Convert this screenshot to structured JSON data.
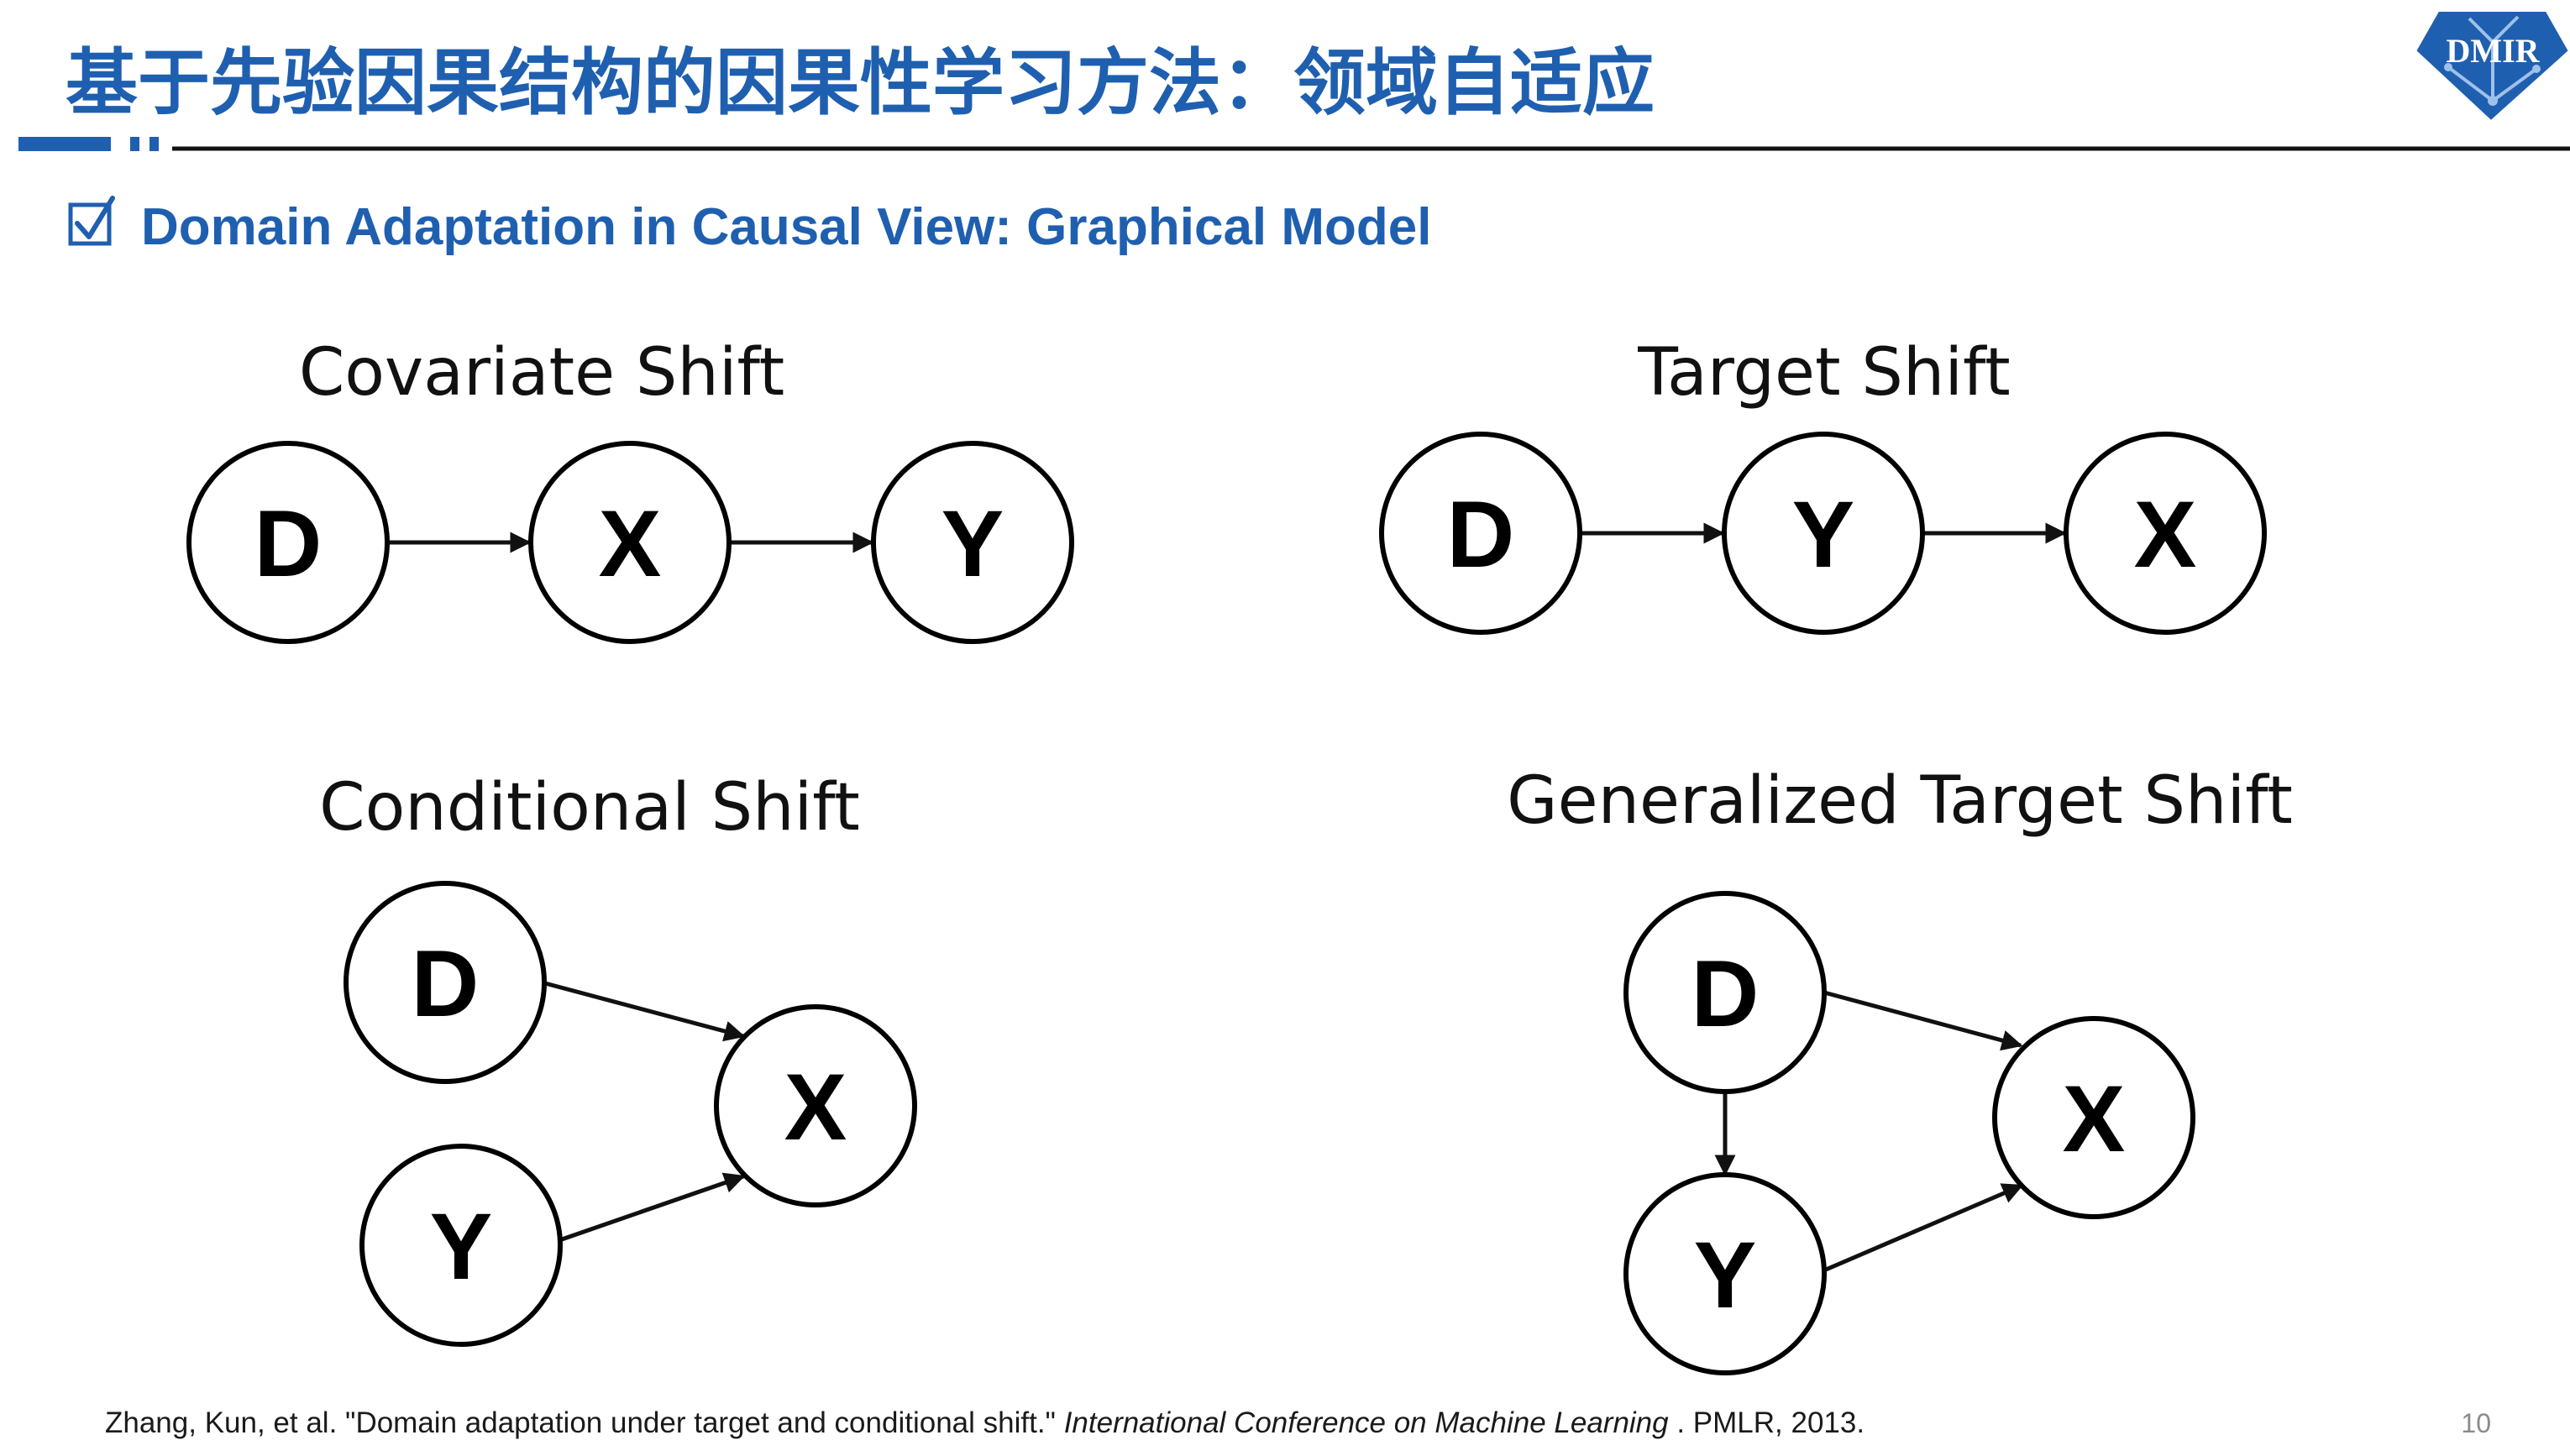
{
  "slide": {
    "title": "基于先验因果结构的因果性学习方法：领域自适应",
    "subtitle": "Domain Adaptation in Causal View: Graphical Model",
    "check_icon": "check-box-icon",
    "logo_text": "DMIR",
    "page_number": "10"
  },
  "diagrams": [
    {
      "title": "Covariate Shift",
      "nodes": [
        {
          "label": "D"
        },
        {
          "label": "X"
        },
        {
          "label": "Y"
        }
      ],
      "edges": [
        {
          "from": "D",
          "to": "X"
        },
        {
          "from": "X",
          "to": "Y"
        }
      ]
    },
    {
      "title": "Target Shift",
      "nodes": [
        {
          "label": "D"
        },
        {
          "label": "Y"
        },
        {
          "label": "X"
        }
      ],
      "edges": [
        {
          "from": "D",
          "to": "Y"
        },
        {
          "from": "Y",
          "to": "X"
        }
      ]
    },
    {
      "title": "Conditional Shift",
      "nodes": [
        {
          "label": "D"
        },
        {
          "label": "Y"
        },
        {
          "label": "X"
        }
      ],
      "edges": [
        {
          "from": "D",
          "to": "X"
        },
        {
          "from": "Y",
          "to": "X"
        }
      ]
    },
    {
      "title": "Generalized Target Shift",
      "nodes": [
        {
          "label": "D"
        },
        {
          "label": "Y"
        },
        {
          "label": "X"
        }
      ],
      "edges": [
        {
          "from": "D",
          "to": "X"
        },
        {
          "from": "D",
          "to": "Y"
        },
        {
          "from": "Y",
          "to": "X"
        }
      ]
    }
  ],
  "reference": {
    "authors_title": "Zhang, Kun, et al. \"Domain adaptation under target and conditional shift.\" ",
    "venue": "International Conference on Machine Learning",
    "publisher_year": ". PMLR, 2013."
  },
  "colors": {
    "accent": "#1f5fb0",
    "logo_fill": "#1f5fb0",
    "rule": "#111111"
  }
}
